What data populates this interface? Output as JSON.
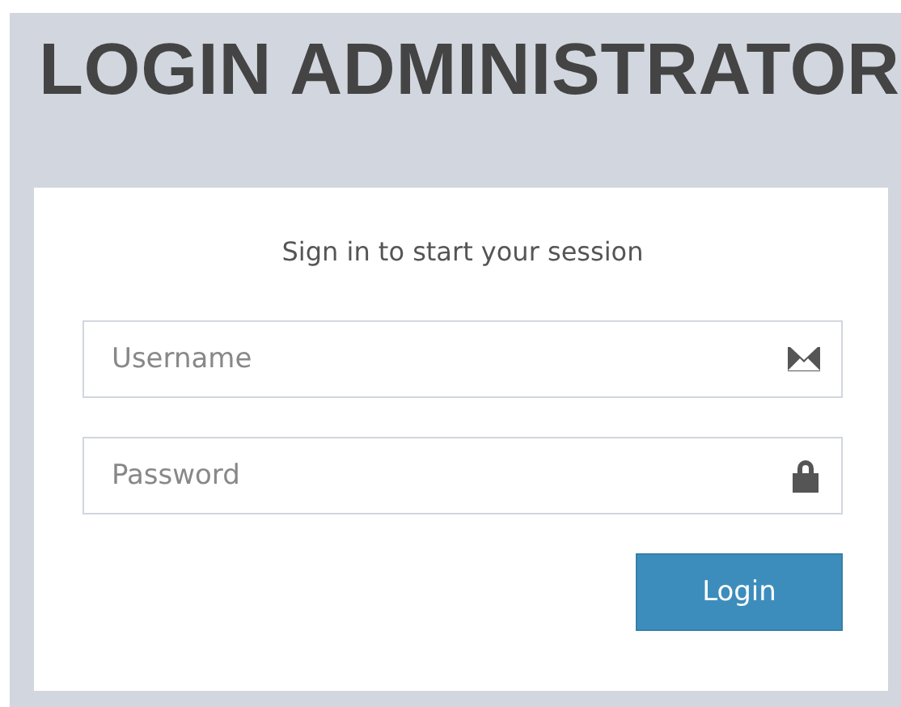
{
  "title": "LOGIN ADMINISTRATOR",
  "message": "Sign in to start your session",
  "fields": [
    {
      "kind": "email",
      "placeholder": "Username"
    },
    {
      "kind": "password",
      "placeholder": "Password"
    }
  ],
  "button": "Login"
}
